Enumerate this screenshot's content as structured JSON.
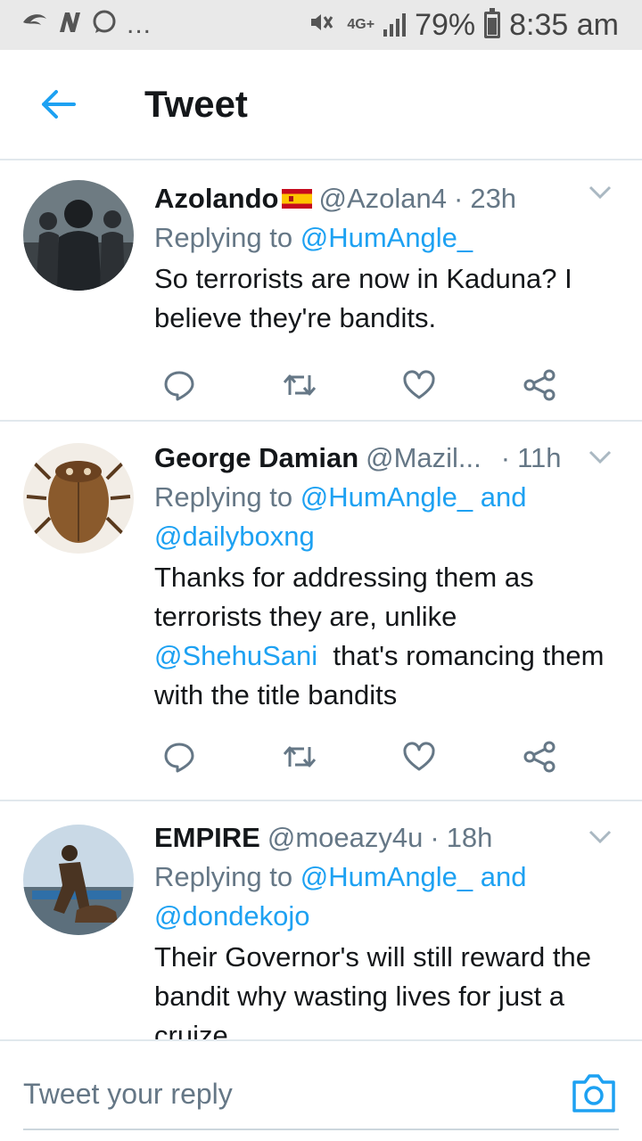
{
  "status_bar": {
    "battery": "79%",
    "time": "8:35 am",
    "network": "4G+",
    "more": "...",
    "left_icons": [
      "sound-icon",
      "notification-n-icon",
      "whatsapp-icon"
    ],
    "right_icons": [
      "mute-icon",
      "signal-icon",
      "battery-icon"
    ]
  },
  "header": {
    "title": "Tweet"
  },
  "colors": {
    "accent": "#1da1f2",
    "text": "#14171a",
    "muted": "#657786",
    "divider": "#e1e8ed"
  },
  "tweets": [
    {
      "name": "Azolando",
      "handle": "@Azolan4",
      "sep": "·",
      "time": "23h",
      "replying_prefix": "Replying to",
      "replying_to": "@HumAngle_",
      "text": "So terrorists are now in Kaduna? I believe they're bandits."
    },
    {
      "name": "George Damian",
      "handle": "@Mazil...",
      "sep": "·",
      "time": "11h",
      "replying_prefix": "Replying to",
      "replying_to": "@HumAngle_",
      "and": "and",
      "replying_to_2": "@dailyboxng",
      "text_before": "Thanks for addressing them as terrorists they are, unlike",
      "text_mention": "@ShehuSani",
      "text_after": "that's romancing them with the title bandits"
    },
    {
      "name": "EMPIRE",
      "handle": "@moeazy4u",
      "sep": "·",
      "time": "18h",
      "replying_prefix": "Replying to",
      "replying_to": "@HumAngle_",
      "and": "and",
      "replying_to_2": "@dondekojo",
      "text": "Their Governor's will still reward the bandit why wasting lives for just a cruize"
    }
  ],
  "reply_bar": {
    "placeholder": "Tweet your reply"
  }
}
